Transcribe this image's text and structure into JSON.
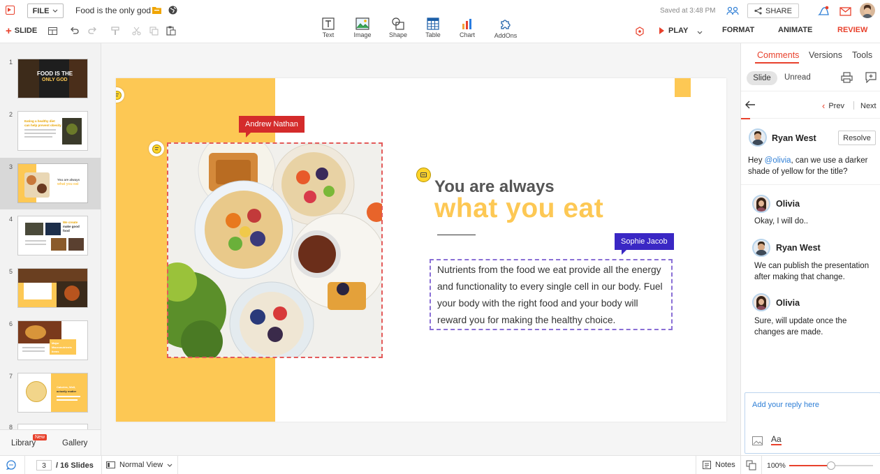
{
  "topbar": {
    "file_label": "FILE",
    "doc_title": "Food is the only god",
    "saved_text": "Saved at 3:48 PM",
    "share_label": "SHARE",
    "add_slide_label": "SLIDE",
    "play_label": "PLAY",
    "insert_items": [
      {
        "label": "Text",
        "icon": "text-icon"
      },
      {
        "label": "Image",
        "icon": "image-icon"
      },
      {
        "label": "Shape",
        "icon": "shape-icon"
      },
      {
        "label": "Table",
        "icon": "table-icon"
      },
      {
        "label": "Chart",
        "icon": "chart-icon"
      },
      {
        "label": "AddOns",
        "icon": "puzzle-icon"
      }
    ],
    "right_tabs": [
      "FORMAT",
      "ANIMATE",
      "REVIEW"
    ],
    "active_tab": "REVIEW"
  },
  "thumbnails": {
    "numbers": [
      "1",
      "2",
      "3",
      "4",
      "5",
      "6",
      "7",
      "8"
    ],
    "selected": "3",
    "t1_title_line1": "FOOD IS THE",
    "t1_title_line2": "ONLY GOD",
    "t2_text_line1": "Eating a healthy diet",
    "t2_text_line2": "can help prevent obesity",
    "t3_text_line1": "You are always",
    "t3_text_line2": "what you eat",
    "t4_text_line1": "We create",
    "t4_text_line2": "make good",
    "t4_text_line3": "food",
    "t6_text_line1": "Major",
    "t6_text_line2": "Macronutrients",
    "t6_text_line3": "items",
    "t7_text_line1": "Calories, Well,",
    "t7_text_line2": "actually matter"
  },
  "leftbottom": {
    "library_label": "Library",
    "new_badge": "New",
    "gallery_label": "Gallery"
  },
  "slide": {
    "title_line1": "You are always",
    "title_line2": "what you eat",
    "body_text": "Nutrients from the food we eat provide all the energy and functionality to every single cell in our body. Fuel your body with the right food and your body will reward you for making the healthy choice.",
    "tag_andrew": "Andrew Nathan",
    "tag_sophie": "Sophie Jacob"
  },
  "panel": {
    "tabs": [
      "Comments",
      "Versions",
      "Tools"
    ],
    "active_tab": "Comments",
    "filter_slide": "Slide",
    "filter_unread": "Unread",
    "prev_label": "Prev",
    "next_label": "Next",
    "thread": {
      "author": "Ryan West",
      "resolve_label": "Resolve",
      "text_before": "Hey ",
      "mention": "@olivia",
      "text_after": ", can we use a darker shade of yellow for the title?"
    },
    "replies": [
      {
        "author": "Olivia",
        "text": "Okay, I will do.."
      },
      {
        "author": "Ryan West",
        "text": "We can publish the presentation after making that change."
      },
      {
        "author": "Olivia",
        "text": "Sure, will update once the changes are made."
      }
    ],
    "reply_placeholder": "Add your reply here",
    "format_label": "Aa"
  },
  "bottombar": {
    "current_slide": "3",
    "total_slides": "/ 16 Slides",
    "view_label": "Normal View",
    "notes_label": "Notes",
    "zoom_label": "100%",
    "zoom_fraction": 0.5
  },
  "colors": {
    "accent_red": "#e8412c",
    "yellow": "#fdc854",
    "title_gray": "#555555",
    "andrew_tag": "#d42b2b",
    "sophie_tag": "#3a27c4",
    "mention_blue": "#2f7fd6"
  }
}
